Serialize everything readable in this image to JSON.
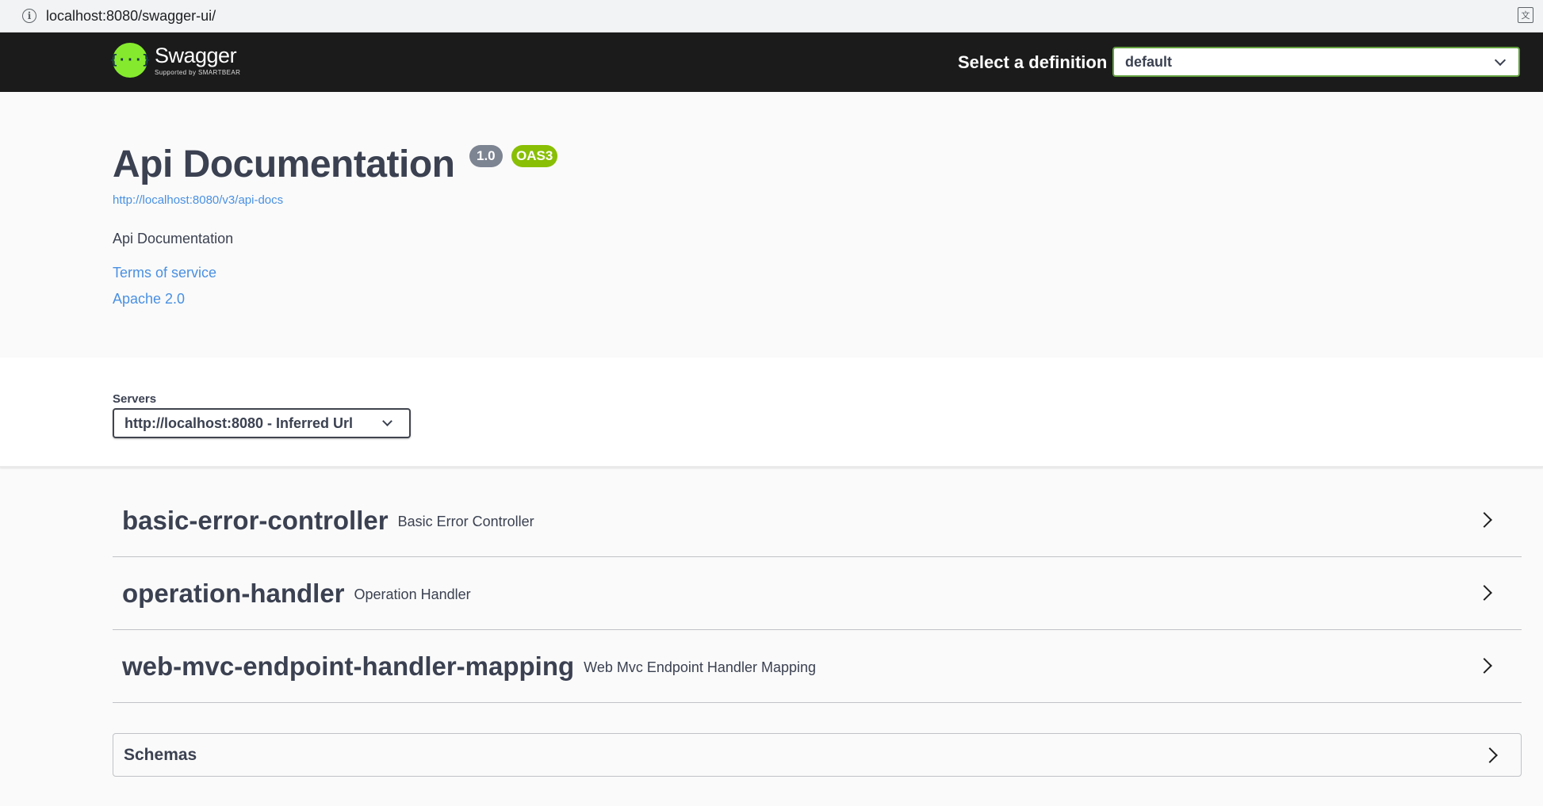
{
  "browser": {
    "url": "localhost:8080/swagger-ui/",
    "info_icon": "info-icon",
    "translate_icon": "translate-icon"
  },
  "topbar": {
    "logo_icon": "swagger-logo-icon",
    "logo_glyph": "{···}",
    "logo_name": "Swagger",
    "logo_sub": "Supported by SMARTBEAR",
    "definition_label": "Select a definition",
    "definition_value": "default",
    "accent_color": "#85ea2d"
  },
  "info": {
    "title": "Api Documentation",
    "version": "1.0",
    "oas_badge": "OAS3",
    "api_docs_url": "http://localhost:8080/v3/api-docs",
    "description": "Api Documentation",
    "terms_link": "Terms of service",
    "license_link": "Apache 2.0"
  },
  "servers": {
    "label": "Servers",
    "selected": "http://localhost:8080 - Inferred Url"
  },
  "tags": [
    {
      "name": "basic-error-controller",
      "description": "Basic Error Controller"
    },
    {
      "name": "operation-handler",
      "description": "Operation Handler"
    },
    {
      "name": "web-mvc-endpoint-handler-mapping",
      "description": "Web Mvc Endpoint Handler Mapping"
    }
  ],
  "schemas": {
    "label": "Schemas"
  }
}
